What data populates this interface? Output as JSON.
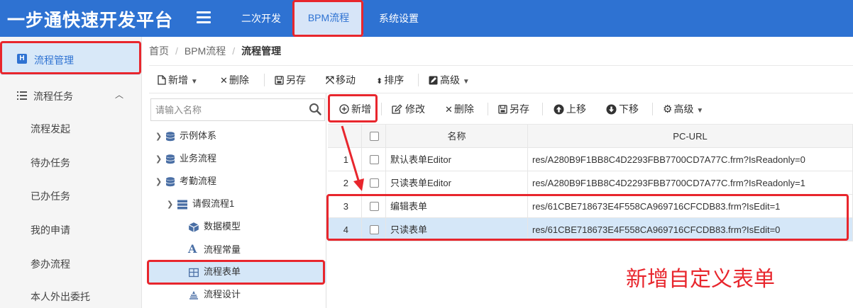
{
  "app": {
    "title": "一步通快速开发平台"
  },
  "topnav": {
    "items": [
      "二次开发",
      "BPM流程",
      "系统设置"
    ]
  },
  "sidebar": {
    "active_item": "流程管理",
    "group": "流程任务",
    "sub_items": [
      "流程发起",
      "待办任务",
      "已办任务",
      "我的申请",
      "参办流程",
      "本人外出委托"
    ]
  },
  "breadcrumb": [
    "首页",
    "BPM流程",
    "流程管理"
  ],
  "toolbar1": {
    "new": "新增",
    "delete": "删除",
    "save_as": "另存",
    "move": "移动",
    "sort": "排序",
    "advanced": "高级"
  },
  "tree": {
    "search_placeholder": "请输入名称",
    "nodes": [
      "示例体系",
      "业务流程",
      "考勤流程",
      "请假流程1",
      "数据模型",
      "流程常量",
      "流程表单",
      "流程设计"
    ]
  },
  "toolbar2": {
    "new": "新增",
    "edit": "修改",
    "delete": "删除",
    "save_as": "另存",
    "move_up": "上移",
    "move_down": "下移",
    "advanced": "高级"
  },
  "grid": {
    "columns": [
      "名称",
      "PC-URL"
    ],
    "rows": [
      {
        "no": "1",
        "name": "默认表单Editor",
        "url": "res/A280B9F1BB8C4D2293FBB7700CD7A77C.frm?IsReadonly=0"
      },
      {
        "no": "2",
        "name": "只读表单Editor",
        "url": "res/A280B9F1BB8C4D2293FBB7700CD7A77C.frm?IsReadonly=1"
      },
      {
        "no": "3",
        "name": "编辑表单",
        "url": "res/61CBE718673E4F558CA969716CFCDB83.frm?IsEdit=1"
      },
      {
        "no": "4",
        "name": "只读表单",
        "url": "res/61CBE718673E4F558CA969716CFCDB83.frm?IsEdit=0"
      }
    ]
  },
  "annotation": {
    "text": "新增自定义表单",
    "color": "#e8262d"
  },
  "colors": {
    "brand": "#2e72d2",
    "selected": "#d5e7f8"
  }
}
